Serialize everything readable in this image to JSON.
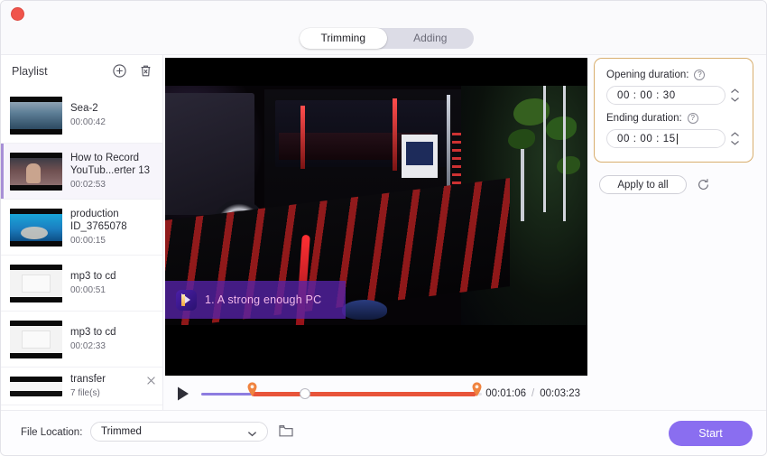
{
  "window": {
    "close_label": "",
    "tabs": [
      {
        "label": "Trimming",
        "active": true
      },
      {
        "label": "Adding",
        "active": false
      }
    ]
  },
  "playlist": {
    "title": "Playlist",
    "add_icon": "circle-plus-icon",
    "delete_icon": "trash-icon",
    "items": [
      {
        "name": "Sea-2",
        "time": "00:00:42",
        "selected": false
      },
      {
        "name": "How to Record YouTub...erter 13",
        "time": "00:02:53",
        "selected": true
      },
      {
        "name": "production ID_3765078",
        "time": "00:00:15",
        "selected": false
      },
      {
        "name": "mp3 to cd",
        "time": "00:00:51",
        "selected": false
      },
      {
        "name": "mp3 to cd",
        "time": "00:02:33",
        "selected": false
      },
      {
        "name": "transfer",
        "time": "7 file(s)",
        "selected": false,
        "closable": true
      }
    ]
  },
  "preview": {
    "caption_text": "1. A strong enough PC",
    "caption_icon": "app-logo-icon",
    "play_icon": "play-icon",
    "current_time": "00:01:06",
    "time_separator": "/",
    "total_time": "00:03:23"
  },
  "settings": {
    "opening_label": "Opening duration:",
    "opening_help": "?",
    "opening_value": "00 : 00 : 30",
    "ending_label": "Ending duration:",
    "ending_help": "?",
    "ending_value": "00 : 00 : 15",
    "apply_label": "Apply to all",
    "reset_icon": "reset-icon"
  },
  "footer": {
    "file_location_label": "File Location:",
    "file_location_value": "Trimmed",
    "folder_icon": "folder-icon",
    "start_label": "Start"
  },
  "colors": {
    "accent_purple": "#8a6ef0",
    "trim_orange": "#e8543a",
    "highlight_border": "#d8ae6e",
    "selected_item_bar": "#a78fd6",
    "caption_bg": "#5622a8",
    "caption_text": "#f2b7ea",
    "close_dot": "#f0544b"
  }
}
